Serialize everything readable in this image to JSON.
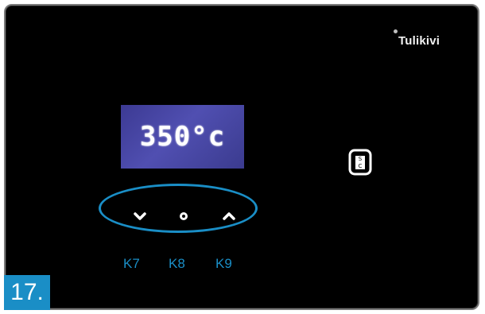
{
  "brand": "Tulikivi",
  "display": {
    "temperature": "350°c"
  },
  "keys": [
    {
      "id": "K7",
      "label": "K7",
      "icon": "chevron-down-icon"
    },
    {
      "id": "K8",
      "label": "K8",
      "icon": "center-dot-icon"
    },
    {
      "id": "K9",
      "label": "K9",
      "icon": "chevron-up-icon"
    }
  ],
  "status_icon": "fuel-door-icon",
  "step_badge": "17.",
  "colors": {
    "accent": "#1a8ec6",
    "panel": "#000000",
    "lcd": "#4a48a8"
  }
}
